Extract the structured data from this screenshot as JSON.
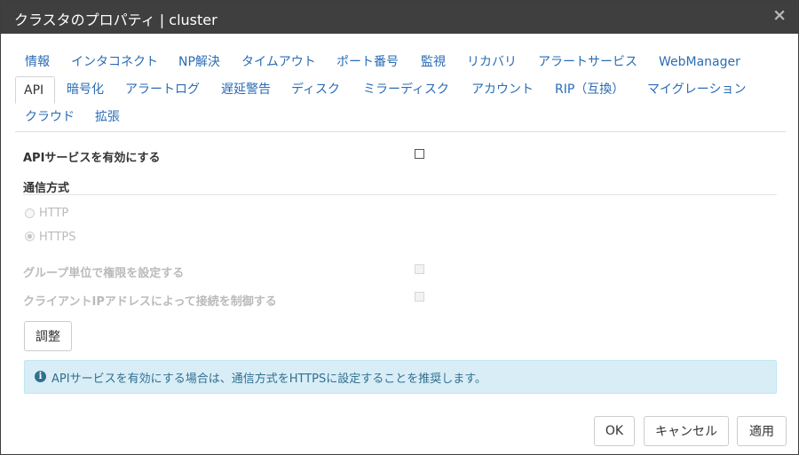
{
  "dialog": {
    "title": "クラスタのプロパティ | cluster",
    "close_glyph": "×"
  },
  "tabs": {
    "row1": [
      "情報",
      "インタコネクト",
      "NP解決",
      "タイムアウト",
      "ポート番号",
      "監視",
      "リカバリ",
      "アラートサービス",
      "WebManager"
    ],
    "row2": [
      "API",
      "暗号化",
      "アラートログ",
      "遅延警告",
      "ディスク",
      "ミラーディスク",
      "アカウント",
      "RIP（互換）",
      "マイグレーション"
    ],
    "row3": [
      "クラウド",
      "拡張"
    ],
    "active": "API"
  },
  "api": {
    "enable_label": "APIサービスを有効にする",
    "enable_checked": false,
    "comm_section": "通信方式",
    "http_label": "HTTP",
    "https_label": "HTTPS",
    "selected_protocol": "HTTPS",
    "group_auth_label": "グループ単位で権限を設定する",
    "ip_control_label": "クライアントIPアドレスによって接続を制御する",
    "tune_button": "調整"
  },
  "info": {
    "icon": "info-circle-icon",
    "message": "APIサービスを有効にする場合は、通信方式をHTTPSに設定することを推奨します。",
    "color": "#31708f",
    "background": "#d9edf7"
  },
  "footer": {
    "ok": "OK",
    "cancel": "キャンセル",
    "apply": "適用"
  }
}
